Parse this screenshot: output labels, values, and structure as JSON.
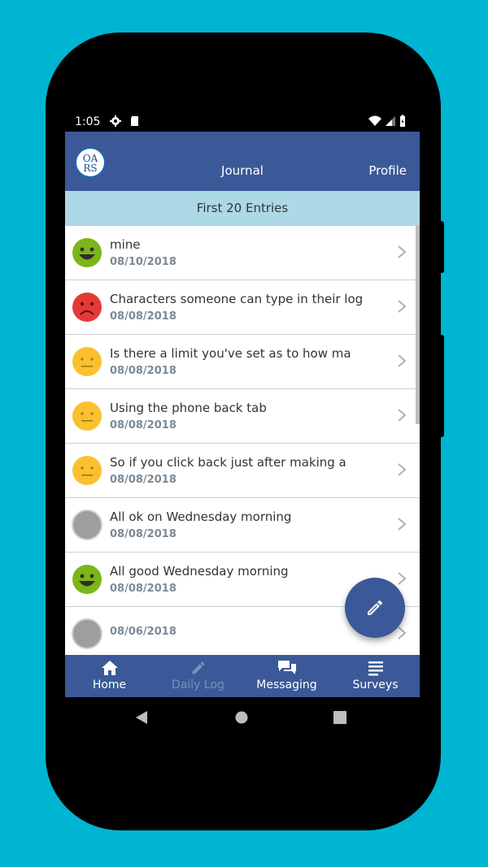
{
  "status_bar": {
    "time": "1:05"
  },
  "app_bar": {
    "logo_text_top": "OA",
    "logo_text_bottom": "RS",
    "title": "Journal",
    "profile_label": "Profile",
    "color": "#3b5998"
  },
  "list": {
    "header": "First 20 Entries",
    "entries": [
      {
        "mood": "happy",
        "text": "mine",
        "date": "08/10/2018"
      },
      {
        "mood": "sad",
        "text": "Characters someone can type in their log",
        "date": "08/08/2018"
      },
      {
        "mood": "neutral",
        "text": "Is there a limit you've set as to how ma",
        "date": "08/08/2018"
      },
      {
        "mood": "neutral",
        "text": "Using the phone back tab",
        "date": "08/08/2018"
      },
      {
        "mood": "neutral",
        "text": "So if you click back just after making a",
        "date": "08/08/2018"
      },
      {
        "mood": "none",
        "text": "All ok on Wednesday morning",
        "date": "08/08/2018"
      },
      {
        "mood": "happy",
        "text": "All good Wednesday morning",
        "date": "08/08/2018"
      },
      {
        "mood": "none",
        "text": "",
        "date": "08/06/2018"
      }
    ]
  },
  "fab": {
    "icon": "pencil-icon"
  },
  "bottom_nav": {
    "home_label": "Home",
    "daily_log_label": "Daily Log",
    "messaging_label": "Messaging",
    "surveys_label": "Surveys"
  },
  "colors": {
    "background": "#00b5d1",
    "happy": "#7cb518",
    "sad": "#e53935",
    "neutral": "#fbc02d",
    "none": "#9e9e9e",
    "header_bg": "#add8e6"
  }
}
